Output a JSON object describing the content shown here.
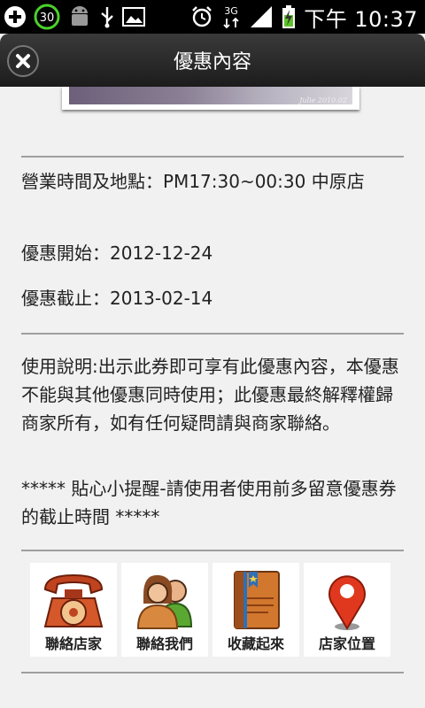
{
  "status_bar": {
    "notification_count": "30",
    "network": "3G",
    "time": "下午 10:37"
  },
  "header": {
    "title": "優惠內容"
  },
  "photo": {
    "signature": "Julie 2010.02"
  },
  "details": {
    "hours_location": "營業時間及地點：PM17:30~00:30 中原店",
    "start": "優惠開始：2012-12-24",
    "end": "優惠截止：2013-02-14"
  },
  "instructions": "使用說明:出示此券即可享有此優惠內容，本優惠不能與其他優惠同時使用；此優惠最終解釋權歸商家所有，如有任何疑問請與商家聯絡。",
  "reminder": "***** 貼心小提醒-請使用者使用前多留意優惠券的截止時間 *****",
  "actions": [
    {
      "label": "聯絡店家",
      "icon": "telephone-icon"
    },
    {
      "label": "聯絡我們",
      "icon": "people-icon"
    },
    {
      "label": "收藏起來",
      "icon": "bookmark-book-icon"
    },
    {
      "label": "店家位置",
      "icon": "map-pin-icon"
    }
  ],
  "colors": {
    "background": "#f1f1f1",
    "titlebar": "#262626",
    "divider": "#9e9e9e"
  }
}
